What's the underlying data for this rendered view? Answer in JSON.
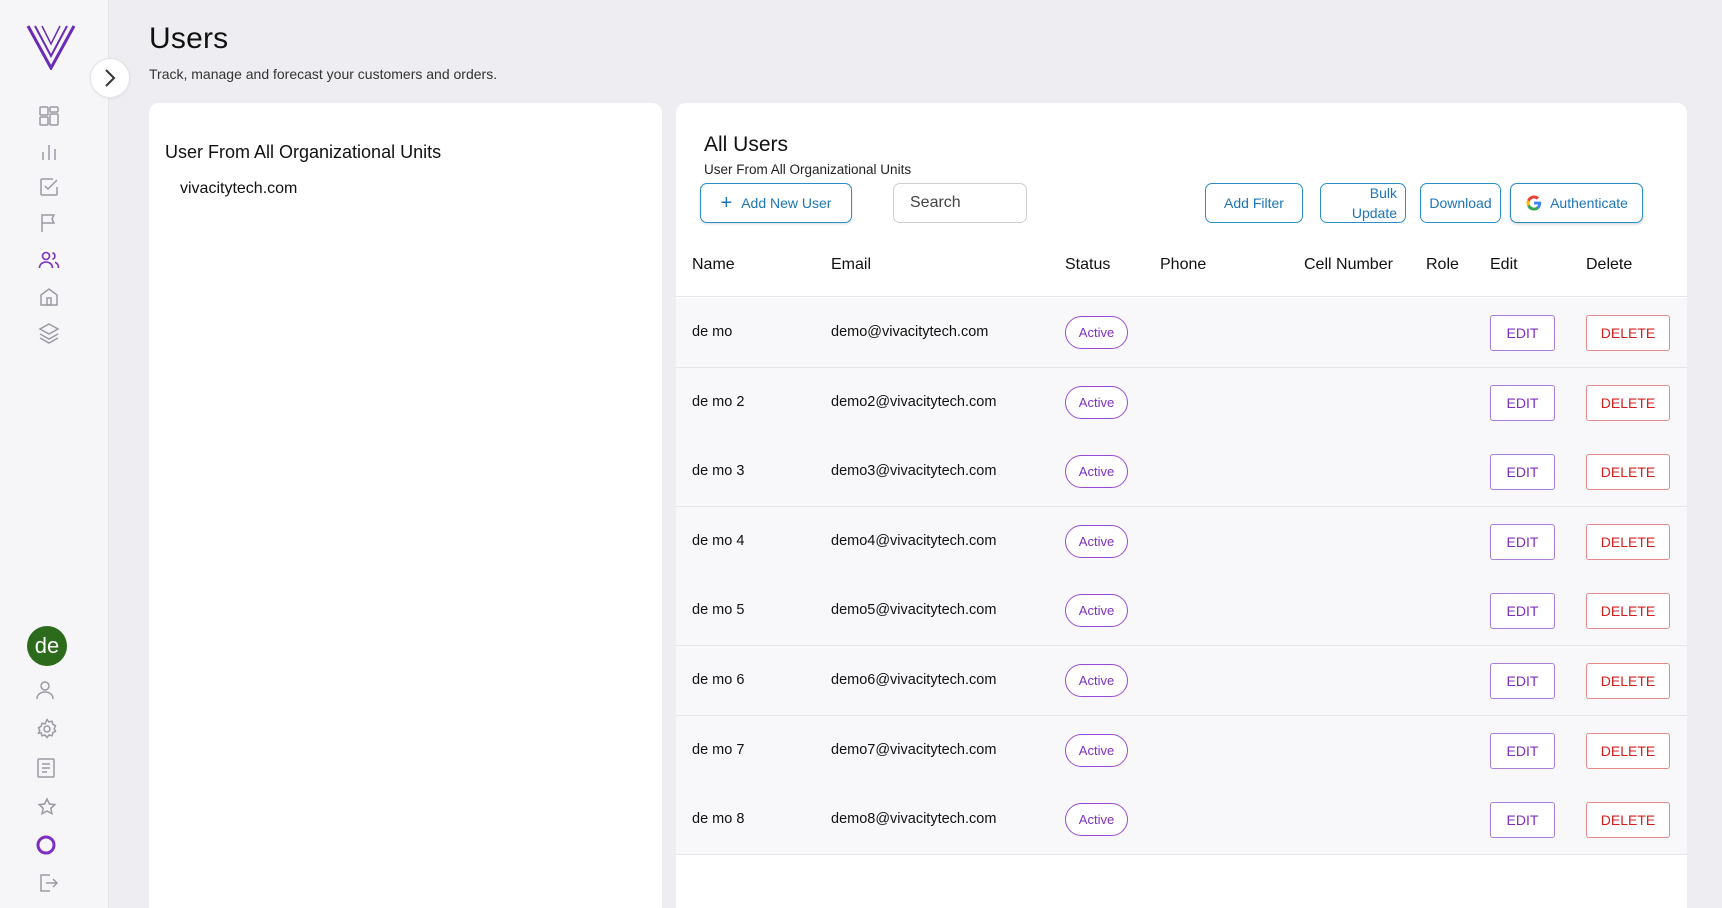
{
  "header": {
    "title": "Users",
    "subtitle": "Track, manage and forecast your customers and orders."
  },
  "sidebar": {
    "avatar_initials": "de",
    "avatar_color": "#2c6a1c",
    "accent_color": "#7e2fbf"
  },
  "org_panel": {
    "title": "User From All Organizational Units",
    "org_item": "vivacitytech.com"
  },
  "users_panel": {
    "title": "All Users",
    "subtitle": "User From All Organizational Units",
    "add_user_label": "Add New User",
    "search_placeholder": "Search",
    "add_filter_label": "Add Filter",
    "bulk_update_line1": "Bulk",
    "bulk_update_line2": "Update",
    "download_label": "Download",
    "authenticate_label": "Authenticate"
  },
  "table": {
    "columns": [
      "Name",
      "Email",
      "Status",
      "Phone",
      "Cell Number",
      "Role",
      "Edit",
      "Delete"
    ],
    "edit_label": "EDIT",
    "delete_label": "DELETE",
    "rows": [
      {
        "name": "de mo",
        "email": "demo@vivacitytech.com",
        "status": "Active",
        "phone": "",
        "cell": "",
        "role": ""
      },
      {
        "name": "de mo 2",
        "email": "demo2@vivacitytech.com",
        "status": "Active",
        "phone": "",
        "cell": "",
        "role": ""
      },
      {
        "name": "de mo 3",
        "email": "demo3@vivacitytech.com",
        "status": "Active",
        "phone": "",
        "cell": "",
        "role": ""
      },
      {
        "name": "de mo 4",
        "email": "demo4@vivacitytech.com",
        "status": "Active",
        "phone": "",
        "cell": "",
        "role": ""
      },
      {
        "name": "de mo 5",
        "email": "demo5@vivacitytech.com",
        "status": "Active",
        "phone": "",
        "cell": "",
        "role": ""
      },
      {
        "name": "de mo 6",
        "email": "demo6@vivacitytech.com",
        "status": "Active",
        "phone": "",
        "cell": "",
        "role": ""
      },
      {
        "name": "de mo 7",
        "email": "demo7@vivacitytech.com",
        "status": "Active",
        "phone": "",
        "cell": "",
        "role": ""
      },
      {
        "name": "de mo 8",
        "email": "demo8@vivacitytech.com",
        "status": "Active",
        "phone": "",
        "cell": "",
        "role": ""
      }
    ]
  }
}
